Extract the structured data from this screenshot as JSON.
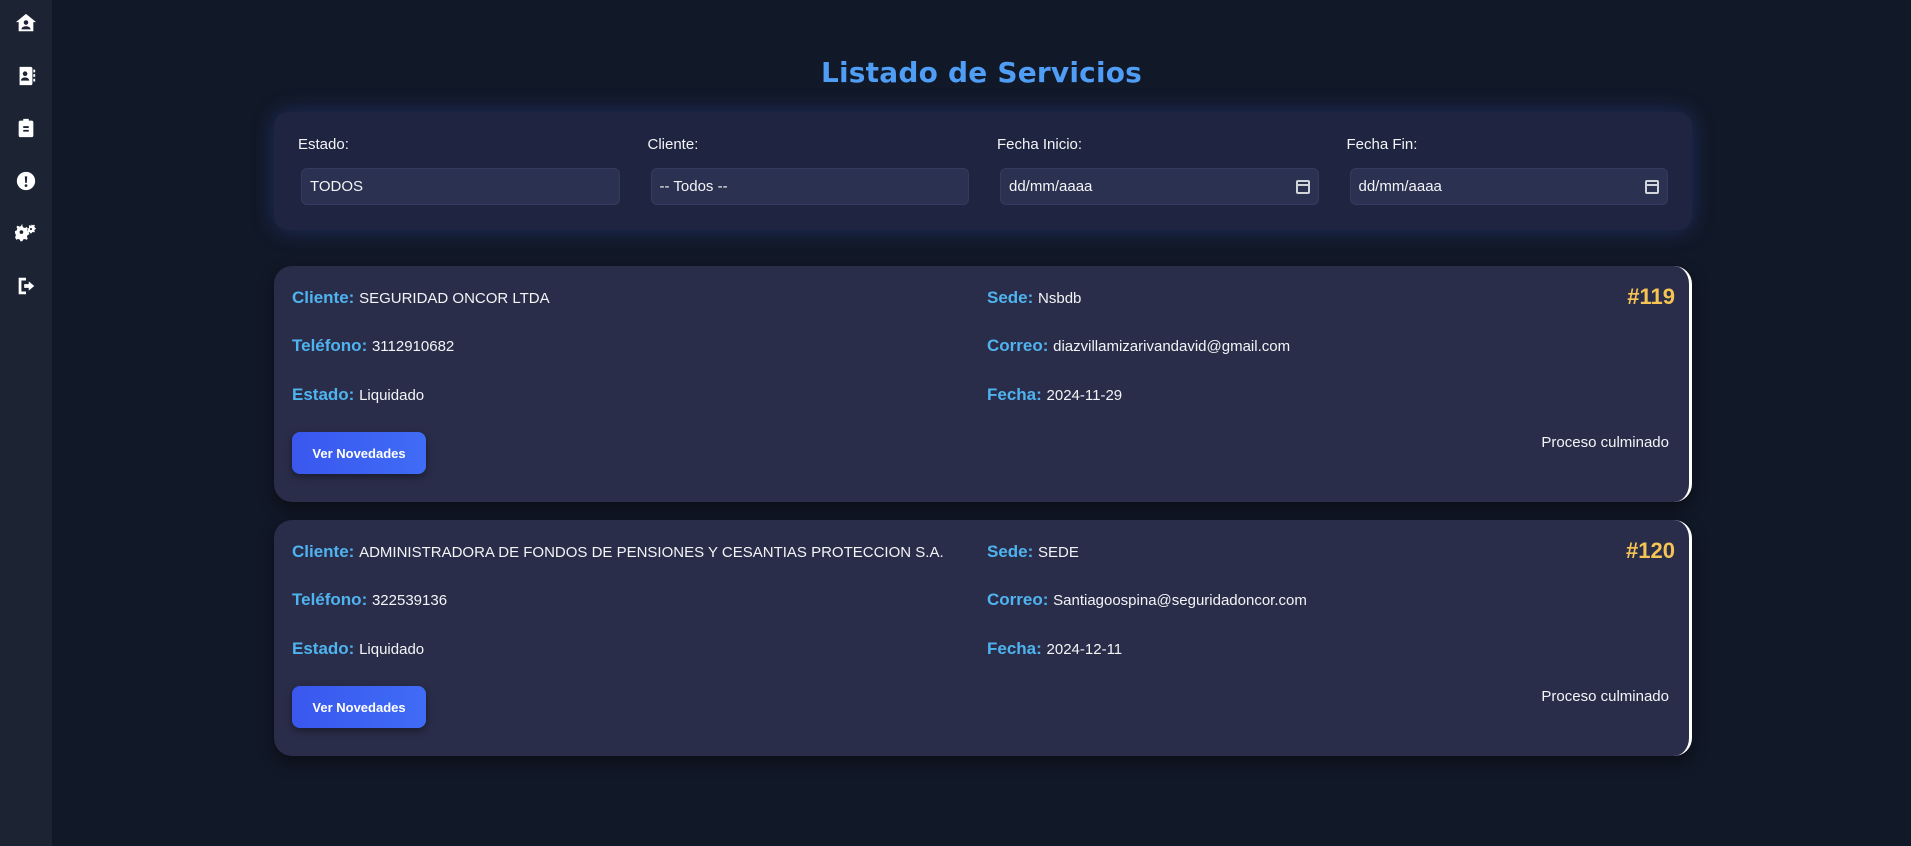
{
  "sidebar": {
    "icons": [
      "home-user-icon",
      "contact-book-icon",
      "clipboard-icon",
      "alert-circle-icon",
      "gears-icon",
      "logout-icon"
    ]
  },
  "page": {
    "title": "Listado de Servicios"
  },
  "filters": {
    "estado": {
      "label": "Estado:",
      "value": "TODOS"
    },
    "cliente": {
      "label": "Cliente:",
      "value": "-- Todos --"
    },
    "fecha_inicio": {
      "label": "Fecha Inicio:",
      "value": "dd/mm/aaaa"
    },
    "fecha_fin": {
      "label": "Fecha Fin:",
      "value": "dd/mm/aaaa"
    }
  },
  "labels": {
    "cliente": "Cliente:",
    "telefono": "Teléfono:",
    "estado": "Estado:",
    "sede": "Sede:",
    "correo": "Correo:",
    "fecha": "Fecha:",
    "button": "Ver Novedades"
  },
  "services": [
    {
      "number": "#119",
      "cliente": "SEGURIDAD ONCOR LTDA",
      "telefono": "3112910682",
      "estado": "Liquidado",
      "sede": "Nsbdb",
      "correo": "diazvillamizarivandavid@gmail.com",
      "fecha": "2024-11-29",
      "status_text": "Proceso culminado"
    },
    {
      "number": "#120",
      "cliente": "ADMINISTRADORA DE FONDOS DE PENSIONES Y CESANTIAS PROTECCION S.A.",
      "telefono": "322539136",
      "estado": "Liquidado",
      "sede": "SEDE",
      "correo": "Santiagoospina@seguridadoncor.com",
      "fecha": "2024-12-11",
      "status_text": "Proceso culminado"
    }
  ],
  "colors": {
    "background": "#111827",
    "sidebar": "#1c2434",
    "title": "#4f9df5",
    "label": "#4fb3ef",
    "number": "#f5c454",
    "button": "#3a57ee",
    "card": "#2a2d4a"
  }
}
